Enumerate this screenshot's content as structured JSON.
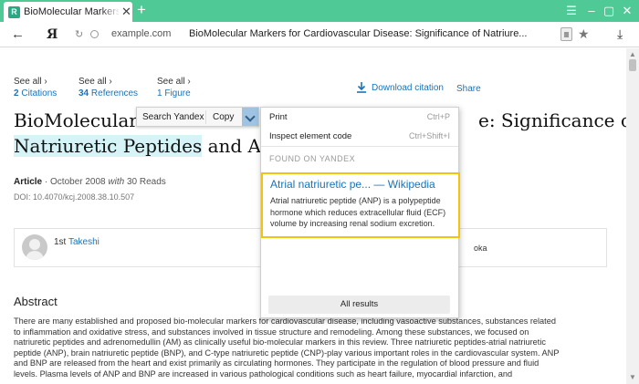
{
  "browser": {
    "tab_title": "BioMolecular Markers for",
    "tab_favicon": "R",
    "tab_close": "✕",
    "new_tab": "+",
    "window_controls": {
      "menu": "☰",
      "minimize": "–",
      "restore": "▢",
      "close": "✕"
    },
    "back": "←",
    "yandex_logo": "Я",
    "reload": "↻",
    "domain": "example.com",
    "page_title": "BioMolecular Markers for Cardiovascular Disease: Significance of Natriure...",
    "star": "★",
    "download": "⤓"
  },
  "page": {
    "stats": [
      {
        "see": "See all ›",
        "count": "2",
        "label": "Citations"
      },
      {
        "see": "See all ›",
        "count": "34",
        "label": "References"
      },
      {
        "see": "See all ›",
        "count": "1",
        "label": "Figure"
      }
    ],
    "download_citation": "Download citation",
    "share": "Share",
    "title_part1": "BioMolecular",
    "title_part1_end": "e: Significance of",
    "title_highlight": "Natriuretic Peptides",
    "title_part2": "and Ad",
    "article_type": "Article",
    "article_date": "· October 2008",
    "with_word": "with",
    "reads": "30 Reads",
    "doi": "DOI: 10.4070/kcj.2008.38.10.507",
    "author_prefix": "1st",
    "author_name": "Takeshi",
    "author2": "oka",
    "abstract_heading": "Abstract",
    "abstract_lines": [
      "There are many established and proposed bio-molecular markers for cardiovascular disease, including vasoactive substances, substances related",
      "to inflammation and oxidative stress, and substances involved in tissue structure and remodeling. Among these substances, we focused on",
      "natriuretic peptides and adrenomedullin (AM) as clinically useful bio-molecular markers in this review. Three natriuretic peptides-atrial natriuretic",
      "peptide (ANP), brain natriuretic peptide (BNP), and C-type natriuretic peptide (CNP)-play various important roles in the cardiovascular system. ANP",
      "and BNP are released from the heart and exist primarily as circulating hormones. They participate in the regulation of blood pressure and fluid",
      "levels. Plasma levels of ANP and BNP are increased in various pathological conditions such as heart failure, myocardial infarction, and"
    ]
  },
  "selection_popup": {
    "search_label": "Search Yandex",
    "copy_label": "Copy"
  },
  "context_menu": {
    "print_label": "Print",
    "print_shortcut": "Ctrl+P",
    "inspect_label": "Inspect element code",
    "inspect_shortcut": "Ctrl+Shift+I",
    "found_heading": "FOUND ON YANDEX",
    "card_title": "Atrial natriuretic pe... — Wikipedia",
    "card_desc": "Atrial natriuretic peptide (ANP) is a polypeptide hormone which reduces extracellular fluid (ECF) volume by increasing renal sodium excretion.",
    "all_results": "All results"
  },
  "scrollbar": {
    "up": "▲",
    "down": "▼"
  },
  "colors": {
    "tabbar": "#4fc995",
    "link": "#1a73b8",
    "highlight": "#d6f3f8",
    "card_border": "#f2c40f"
  }
}
